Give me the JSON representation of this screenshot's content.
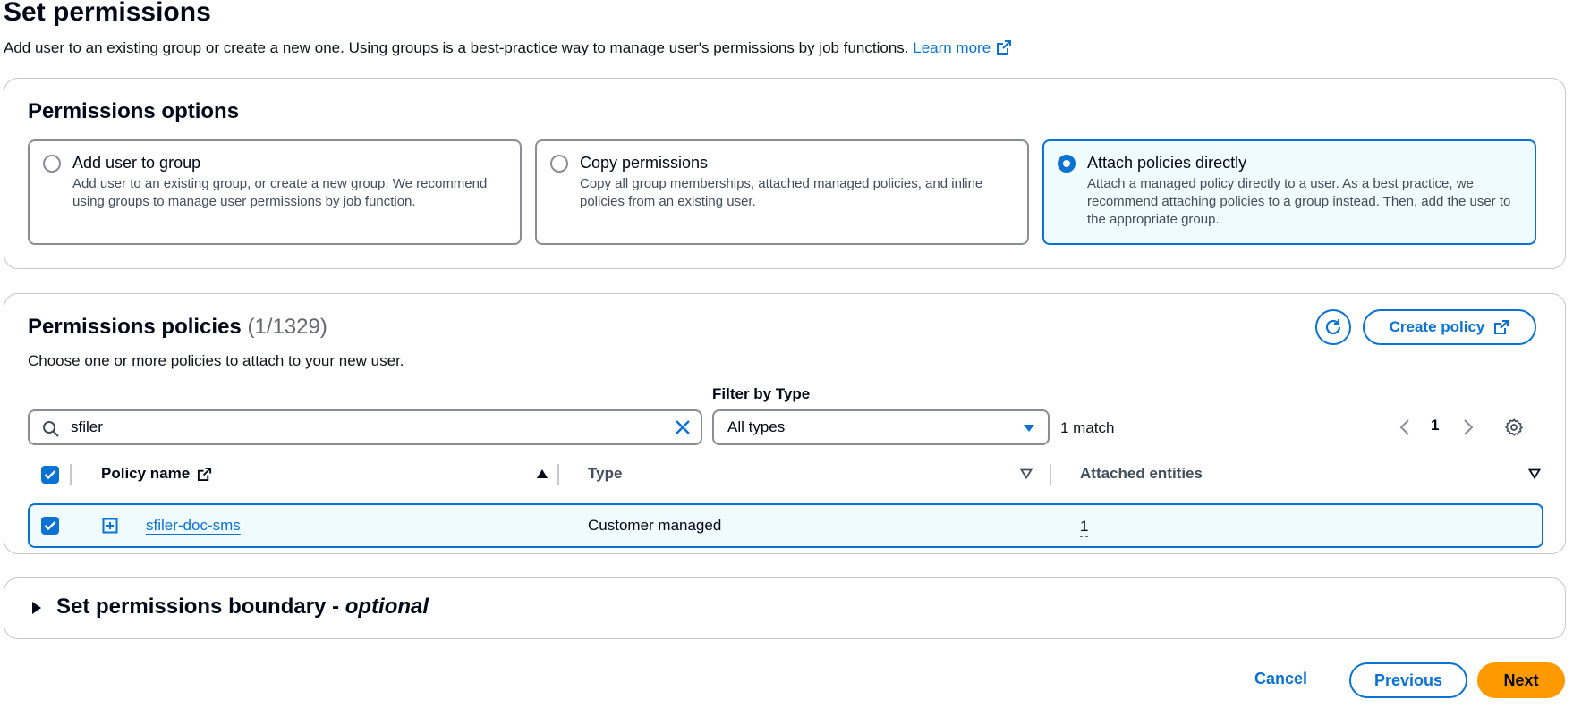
{
  "page": {
    "title": "Set permissions",
    "description": "Add user to an existing group or create a new one. Using groups is a best-practice way to manage user's permissions by job functions.",
    "learn_more": "Learn more",
    "learn_more_icon": "external-link-icon"
  },
  "permissions_options": {
    "heading": "Permissions options",
    "selected": "Attach policies directly",
    "tiles": [
      {
        "label": "Add user to group",
        "description": "Add user to an existing group, or create a new group. We recommend using groups to manage user permissions by job function.",
        "checked": false
      },
      {
        "label": "Copy permissions",
        "description": "Copy all group memberships, attached managed policies, and inline policies from an existing user.",
        "checked": false
      },
      {
        "label": "Attach policies directly",
        "description": "Attach a managed policy directly to a user. As a best practice, we recommend attaching policies to a group instead. Then, add the user to the appropriate group.",
        "checked": true
      }
    ]
  },
  "permissions_policies": {
    "heading": "Permissions policies",
    "count": "(1/1329)",
    "description": "Choose one or more policies to attach to your new user.",
    "refresh_icon": "refresh-icon",
    "create_policy_label": "Create policy",
    "search": {
      "value": "sfiler",
      "icon": "search-icon",
      "clear_icon": "close-icon"
    },
    "filter": {
      "label": "Filter by Type",
      "selected": "All types"
    },
    "match_count": "1 match",
    "pagination": {
      "current_page": "1"
    },
    "settings_icon": "gear-icon",
    "columns": {
      "policy_name": "Policy name",
      "type": "Type",
      "attached_entities": "Attached entities"
    },
    "rows": [
      {
        "checked": true,
        "policy_name": "sfiler-doc-sms",
        "type": "Customer managed",
        "attached_entities": "1"
      }
    ]
  },
  "boundary": {
    "title": "Set permissions boundary - ",
    "title_optional": "optional",
    "expanded": false
  },
  "footer": {
    "cancel": "Cancel",
    "previous": "Previous",
    "next": "Next"
  },
  "colors": {
    "accent": "#0972d3",
    "primary_button": "#ff9900",
    "selected_tile_bg": "#f0fbff"
  }
}
